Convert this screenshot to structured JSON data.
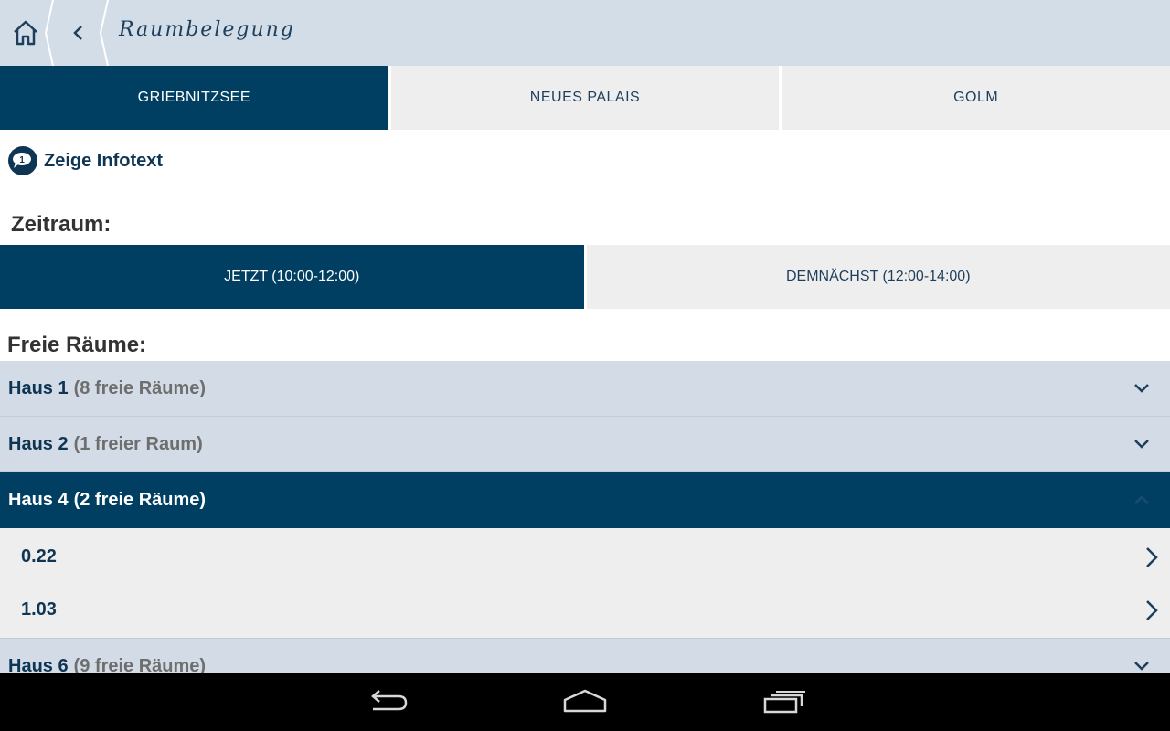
{
  "header": {
    "title": "Raumbelegung"
  },
  "campus_tabs": [
    {
      "label": "GRIEBNITZSEE",
      "active": true
    },
    {
      "label": "NEUES PALAIS",
      "active": false
    },
    {
      "label": "GOLM",
      "active": false
    }
  ],
  "info": {
    "label": "Zeige Infotext"
  },
  "zeitraum": {
    "label": "Zeitraum:",
    "options": [
      {
        "label": "JETZT (10:00-12:00)",
        "active": true
      },
      {
        "label": "DEMNÄCHST (12:00-14:00)",
        "active": false
      }
    ]
  },
  "freie_raeume": {
    "label": "Freie Räume:",
    "buildings": [
      {
        "name": "Haus 1",
        "count": "(8 freie Räume)",
        "expanded": false
      },
      {
        "name": "Haus 2",
        "count": "(1 freier Raum)",
        "expanded": false
      },
      {
        "name": "Haus 4",
        "count": "(2 freie Räume)",
        "expanded": true,
        "rooms": [
          "0.22",
          "1.03"
        ]
      },
      {
        "name": "Haus 6",
        "count": "(9 freie Räume)",
        "expanded": false
      }
    ]
  },
  "colors": {
    "primary": "#003f62",
    "header_bg": "#d3dde8",
    "tab_inactive_bg": "#eeeeee",
    "list_bg": "#d3dce6",
    "text_dark": "#0f3554"
  },
  "icons": {
    "home": "home-icon",
    "back": "chevron-left-icon",
    "info": "info-speech-bubble-icon",
    "expand": "chevron-down-icon",
    "room": "chevron-right-icon",
    "nav_back": "back-arrow-icon",
    "nav_home": "home-outline-icon",
    "nav_recents": "recent-apps-icon"
  }
}
